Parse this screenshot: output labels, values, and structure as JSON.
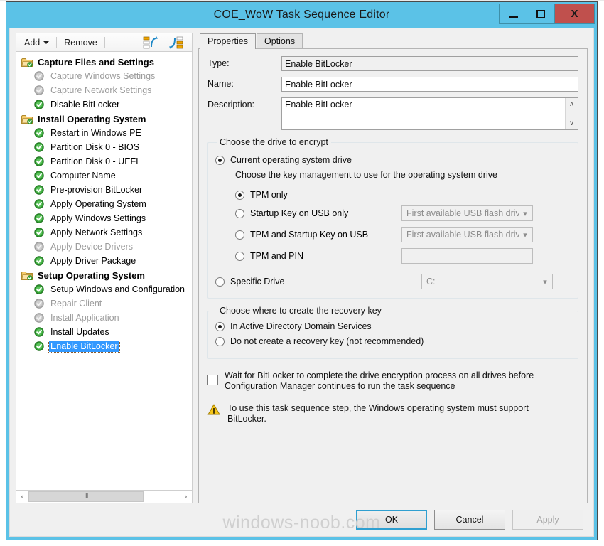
{
  "window": {
    "title": "COE_WoW Task Sequence Editor",
    "minimize_label": "minimize",
    "maximize_label": "maximize",
    "close_label": "X"
  },
  "toolbar": {
    "add_label": "Add",
    "remove_label": "Remove",
    "move_up_icon": "move-up-icon",
    "move_down_icon": "move-down-icon"
  },
  "tree": {
    "items": [
      {
        "label": "Capture Files and Settings",
        "type": "group",
        "icon": "folder-icon",
        "state": "enabled",
        "selected": false
      },
      {
        "label": "Capture Windows Settings",
        "type": "child",
        "icon": "check-circle-icon",
        "state": "disabled",
        "selected": false
      },
      {
        "label": "Capture Network Settings",
        "type": "child",
        "icon": "check-circle-icon",
        "state": "disabled",
        "selected": false
      },
      {
        "label": "Disable BitLocker",
        "type": "child",
        "icon": "check-circle-icon",
        "state": "enabled",
        "selected": false
      },
      {
        "label": "Install Operating System",
        "type": "group",
        "icon": "folder-icon",
        "state": "enabled",
        "selected": false
      },
      {
        "label": "Restart in Windows PE",
        "type": "child",
        "icon": "check-circle-icon",
        "state": "enabled",
        "selected": false
      },
      {
        "label": "Partition Disk 0 - BIOS",
        "type": "child",
        "icon": "check-circle-icon",
        "state": "enabled",
        "selected": false
      },
      {
        "label": "Partition Disk 0 - UEFI",
        "type": "child",
        "icon": "check-circle-icon",
        "state": "enabled",
        "selected": false
      },
      {
        "label": "Computer Name",
        "type": "child",
        "icon": "check-circle-icon",
        "state": "enabled",
        "selected": false
      },
      {
        "label": "Pre-provision BitLocker",
        "type": "child",
        "icon": "check-circle-icon",
        "state": "enabled",
        "selected": false
      },
      {
        "label": "Apply Operating System",
        "type": "child",
        "icon": "check-circle-icon",
        "state": "enabled",
        "selected": false
      },
      {
        "label": "Apply Windows Settings",
        "type": "child",
        "icon": "check-circle-icon",
        "state": "enabled",
        "selected": false
      },
      {
        "label": "Apply Network Settings",
        "type": "child",
        "icon": "check-circle-icon",
        "state": "enabled",
        "selected": false
      },
      {
        "label": "Apply Device Drivers",
        "type": "child",
        "icon": "check-circle-icon",
        "state": "disabled",
        "selected": false
      },
      {
        "label": "Apply Driver Package",
        "type": "child",
        "icon": "check-circle-icon",
        "state": "enabled",
        "selected": false
      },
      {
        "label": "Setup Operating System",
        "type": "group",
        "icon": "folder-icon",
        "state": "enabled",
        "selected": false
      },
      {
        "label": "Setup Windows and Configuration",
        "type": "child",
        "icon": "check-circle-icon",
        "state": "enabled",
        "selected": false
      },
      {
        "label": "Repair Client",
        "type": "child",
        "icon": "check-circle-icon",
        "state": "disabled",
        "selected": false
      },
      {
        "label": "Install Application",
        "type": "child",
        "icon": "check-circle-icon",
        "state": "disabled",
        "selected": false
      },
      {
        "label": "Install Updates",
        "type": "child",
        "icon": "check-circle-icon",
        "state": "enabled",
        "selected": false
      },
      {
        "label": "Enable BitLocker",
        "type": "child",
        "icon": "check-circle-icon",
        "state": "enabled",
        "selected": true
      }
    ],
    "hscroll_left": "‹",
    "hscroll_right": "›",
    "hscroll_grip": "III"
  },
  "tabs": [
    {
      "label": "Properties",
      "active": true
    },
    {
      "label": "Options",
      "active": false
    }
  ],
  "properties": {
    "type_label": "Type:",
    "type_value": "Enable BitLocker",
    "name_label": "Name:",
    "name_value": "Enable BitLocker",
    "description_label": "Description:",
    "description_value": "Enable BitLocker",
    "scroll_up_icon": "∧",
    "scroll_down_icon": "∨"
  },
  "drive_group": {
    "legend": "Choose the drive to encrypt",
    "current_os_drive": {
      "label": "Current operating system drive",
      "selected": true
    },
    "key_note": "Choose the key management to use for the operating system drive",
    "key_options": [
      {
        "label": "TPM only",
        "selected": true,
        "control": "none",
        "value": ""
      },
      {
        "label": "Startup Key on USB only",
        "selected": false,
        "control": "combo",
        "value": "First available USB flash driv"
      },
      {
        "label": "TPM and Startup Key on USB",
        "selected": false,
        "control": "combo",
        "value": "First available USB flash driv"
      },
      {
        "label": "TPM and PIN",
        "selected": false,
        "control": "textbox",
        "value": ""
      }
    ],
    "specific_drive": {
      "label": "Specific Drive",
      "selected": false,
      "value": "C:"
    }
  },
  "recovery_group": {
    "legend": "Choose where to create the recovery key",
    "options": [
      {
        "label": "In Active Directory Domain Services",
        "selected": true
      },
      {
        "label": "Do not create a recovery key (not recommended)",
        "selected": false
      }
    ]
  },
  "wait_checkbox": {
    "checked": false,
    "line1": "Wait for BitLocker to complete the drive encryption process on all drives before",
    "line2": "Configuration Manager continues to run the task sequence"
  },
  "warning": {
    "icon": "warning-triangle-icon",
    "line1": "To use this task sequence step, the Windows operating system must support",
    "line2": "BitLocker."
  },
  "footer": {
    "ok_label": "OK",
    "cancel_label": "Cancel",
    "apply_label": "Apply",
    "apply_disabled": true
  },
  "watermark": "windows-noob.com",
  "colors": {
    "titlebar": "#5bc2e7",
    "close_button": "#c0504d",
    "selection": "#3399ff",
    "default_button_border": "#2f9fd0",
    "warning_yellow": "#f5c518"
  }
}
